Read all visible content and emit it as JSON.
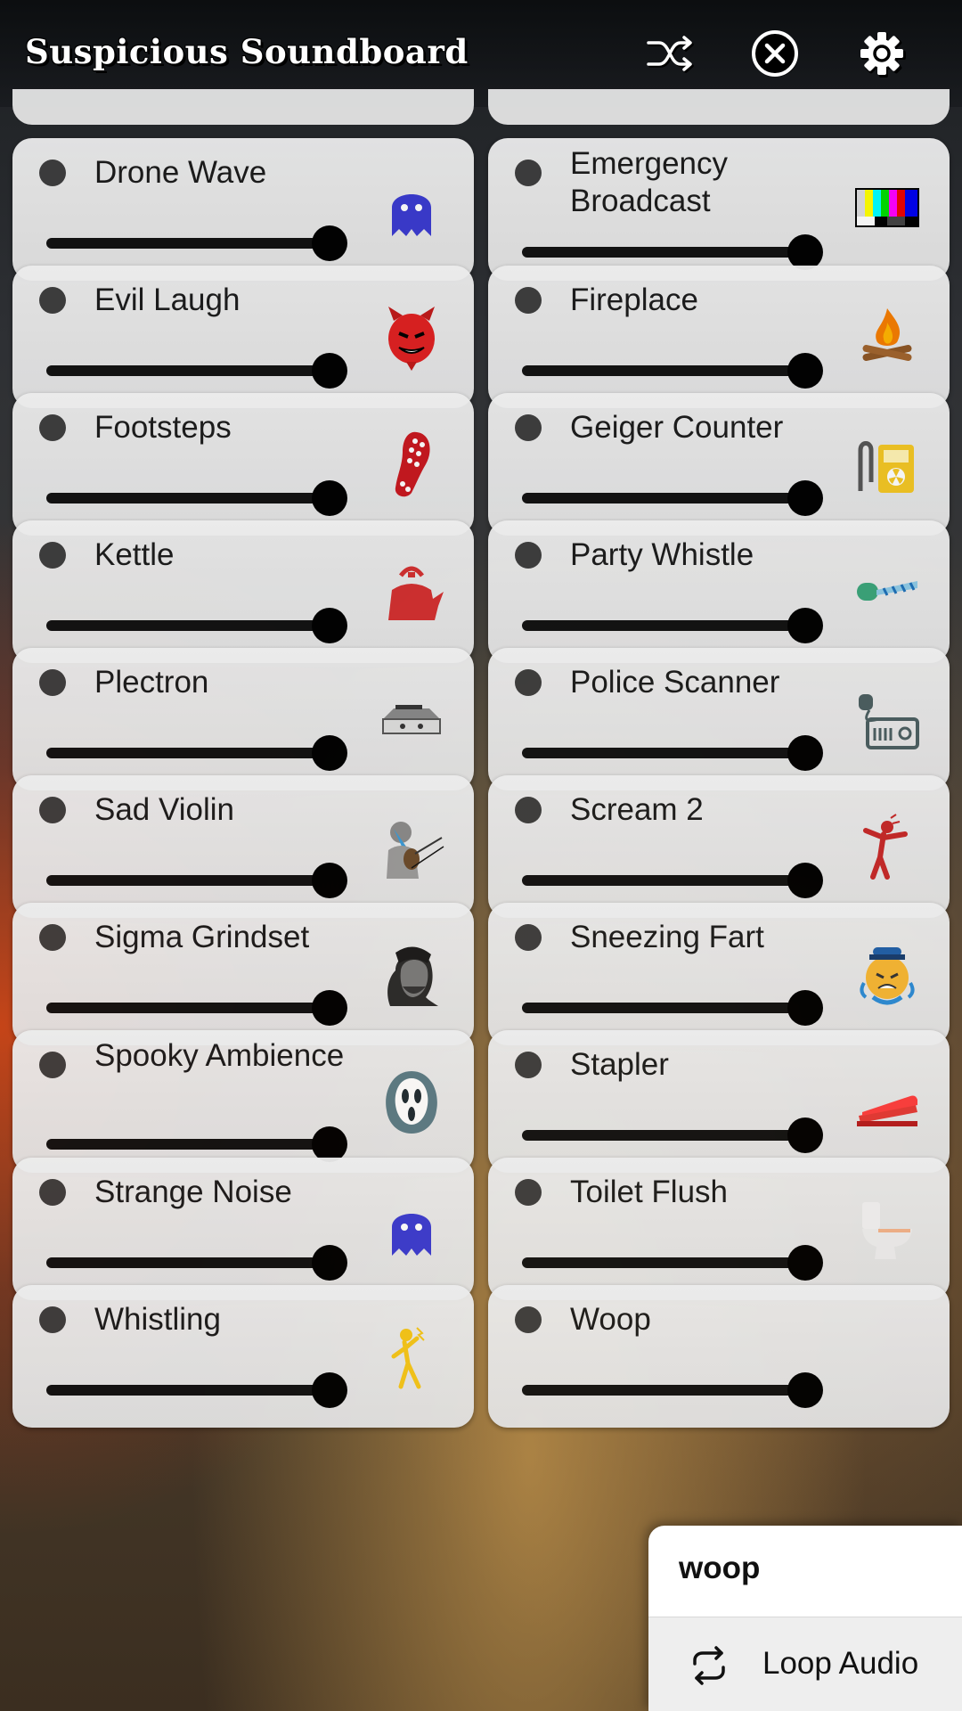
{
  "app": {
    "title": "Suspicious Soundboard"
  },
  "header": {
    "shuffle_icon": "shuffle-icon",
    "stop_icon": "stop-all-icon",
    "settings_icon": "gear-icon"
  },
  "sounds": [
    {
      "label": "Drone Wave",
      "icon": "ghost-icon",
      "volume": 1.0
    },
    {
      "label": "Emergency Broadcast",
      "icon": "test-pattern-icon",
      "volume": 1.0
    },
    {
      "label": "Evil Laugh",
      "icon": "devil-icon",
      "volume": 1.0
    },
    {
      "label": "Fireplace",
      "icon": "campfire-icon",
      "volume": 1.0
    },
    {
      "label": "Footsteps",
      "icon": "shoe-sole-icon",
      "volume": 1.0
    },
    {
      "label": "Geiger Counter",
      "icon": "geiger-counter-icon",
      "volume": 1.0
    },
    {
      "label": "Kettle",
      "icon": "kettle-icon",
      "volume": 1.0
    },
    {
      "label": "Party Whistle",
      "icon": "party-whistle-icon",
      "volume": 1.0
    },
    {
      "label": "Plectron",
      "icon": "plectron-receiver-icon",
      "volume": 1.0
    },
    {
      "label": "Police Scanner",
      "icon": "radio-scanner-icon",
      "volume": 1.0
    },
    {
      "label": "Sad Violin",
      "icon": "violin-player-icon",
      "volume": 1.0
    },
    {
      "label": "Scream 2",
      "icon": "screaming-person-icon",
      "volume": 1.0
    },
    {
      "label": "Sigma Grindset",
      "icon": "chad-face-icon",
      "volume": 1.0
    },
    {
      "label": "Sneezing Fart",
      "icon": "sneezing-face-icon",
      "volume": 1.0
    },
    {
      "label": "Spooky Ambience",
      "icon": "scream-mask-icon",
      "volume": 1.0
    },
    {
      "label": "Stapler",
      "icon": "stapler-icon",
      "volume": 1.0
    },
    {
      "label": "Strange Noise",
      "icon": "ghost-icon",
      "volume": 1.0
    },
    {
      "label": "Toilet Flush",
      "icon": "toilet-icon",
      "volume": 1.0
    },
    {
      "label": "Whistling",
      "icon": "whistling-person-icon",
      "volume": 1.0
    },
    {
      "label": "Woop",
      "icon": "",
      "volume": 1.0
    }
  ],
  "context_menu": {
    "title": "woop",
    "items": [
      {
        "label": "Loop Audio",
        "icon": "loop-icon"
      }
    ]
  },
  "colors": {
    "card_bg": "#e8e8e8",
    "slider": "#000000",
    "indicator": "#3d3d3d"
  }
}
